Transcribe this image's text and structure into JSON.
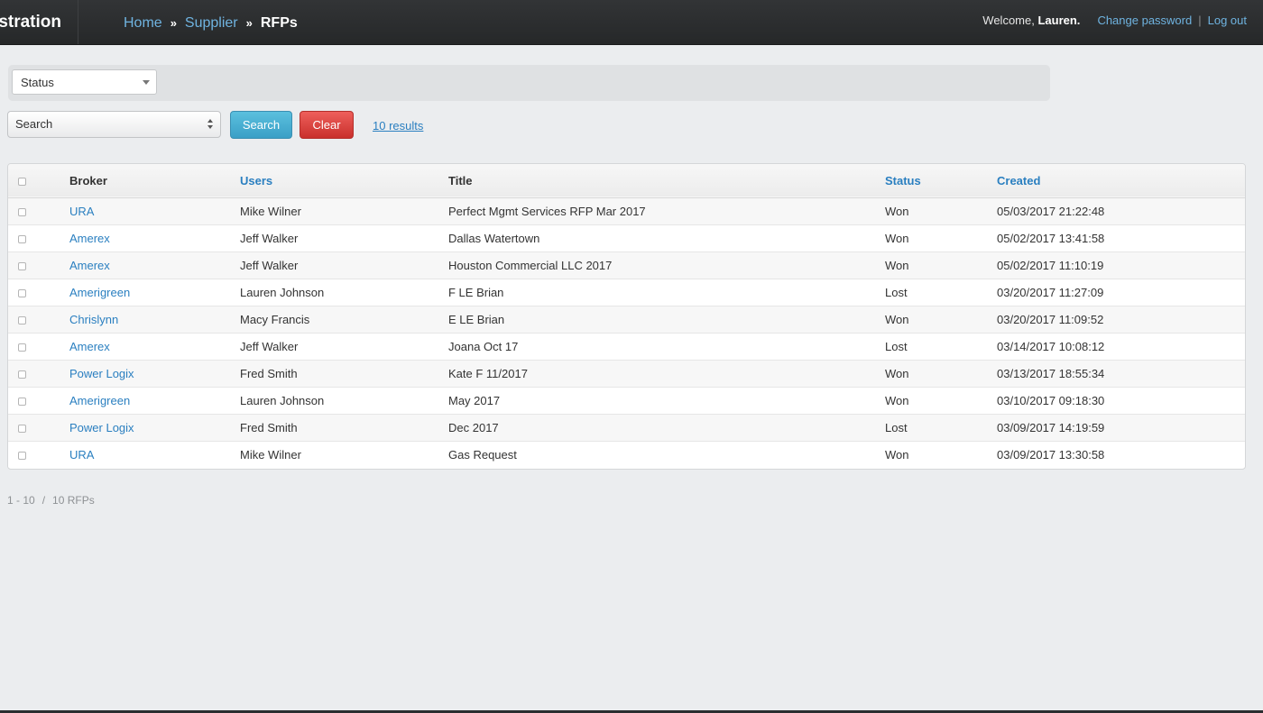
{
  "header": {
    "brand": "stration",
    "breadcrumb": {
      "home": "Home",
      "separator": "»",
      "supplier": "Supplier",
      "current": "RFPs"
    },
    "user": {
      "welcome_prefix": "Welcome, ",
      "name": "Lauren.",
      "change_password": "Change password",
      "separator": "|",
      "logout": "Log out"
    }
  },
  "filters": {
    "status_select": "Status",
    "search_select": "Search",
    "search_button": "Search",
    "clear_button": "Clear",
    "results_link": "10 results"
  },
  "table": {
    "columns": {
      "broker": "Broker",
      "users": "Users",
      "title": "Title",
      "status": "Status",
      "created": "Created"
    },
    "rows": [
      {
        "broker": "URA",
        "users": "Mike Wilner",
        "title": "Perfect Mgmt Services RFP Mar 2017",
        "status": "Won",
        "created": "05/03/2017 21:22:48"
      },
      {
        "broker": "Amerex",
        "users": "Jeff Walker",
        "title": "Dallas Watertown",
        "status": "Won",
        "created": "05/02/2017 13:41:58"
      },
      {
        "broker": "Amerex",
        "users": "Jeff Walker",
        "title": "Houston Commercial LLC 2017",
        "status": "Won",
        "created": "05/02/2017 11:10:19"
      },
      {
        "broker": "Amerigreen",
        "users": "Lauren Johnson",
        "title": "F LE Brian",
        "status": "Lost",
        "created": "03/20/2017 11:27:09"
      },
      {
        "broker": "Chrislynn",
        "users": "Macy Francis",
        "title": "E LE Brian",
        "status": "Won",
        "created": "03/20/2017 11:09:52"
      },
      {
        "broker": "Amerex",
        "users": "Jeff Walker",
        "title": "Joana Oct 17",
        "status": "Lost",
        "created": "03/14/2017 10:08:12"
      },
      {
        "broker": "Power Logix",
        "users": "Fred Smith",
        "title": "Kate F 11/2017",
        "status": "Won",
        "created": "03/13/2017 18:55:34"
      },
      {
        "broker": "Amerigreen",
        "users": "Lauren Johnson",
        "title": "May 2017",
        "status": "Won",
        "created": "03/10/2017 09:18:30"
      },
      {
        "broker": "Power Logix",
        "users": "Fred Smith",
        "title": "Dec 2017",
        "status": "Lost",
        "created": "03/09/2017 14:19:59"
      },
      {
        "broker": "URA",
        "users": "Mike Wilner",
        "title": "Gas Request",
        "status": "Won",
        "created": "03/09/2017 13:30:58"
      }
    ]
  },
  "pagination": {
    "range": "1 - 10",
    "separator": "/",
    "total": "10 RFPs"
  },
  "colors": {
    "topbar": "#2b2d2f",
    "link": "#2a7fc0",
    "breadcrumb_link": "#6fb3e0",
    "search_button": "#3a9fc6",
    "clear_button": "#c9302c",
    "page_background": "#ebedef"
  }
}
